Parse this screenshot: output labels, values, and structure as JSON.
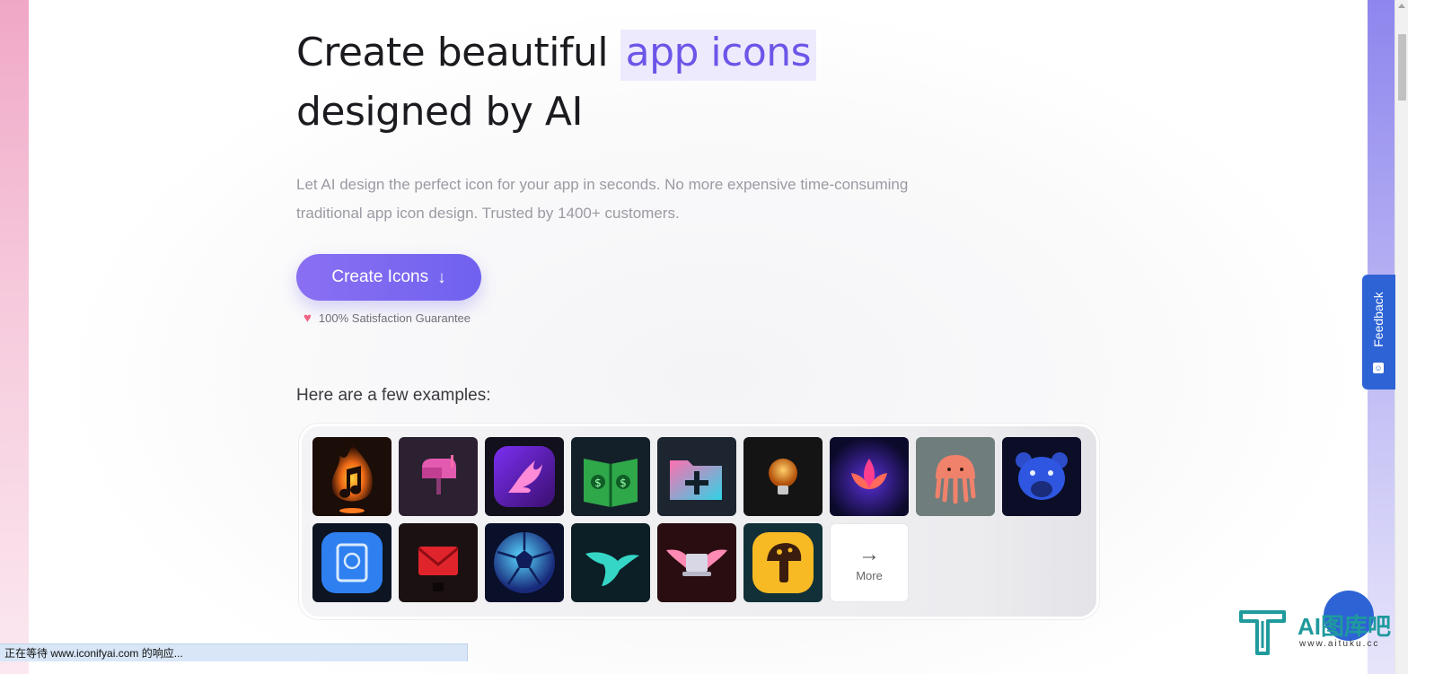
{
  "hero": {
    "headline_part1": "Create beautiful",
    "headline_highlight": "app icons",
    "headline_part2": "designed by AI",
    "subtitle": "Let AI design the perfect icon for your app in seconds. No more expensive time-consuming traditional app icon design. Trusted by 1400+ customers.",
    "cta_label": "Create Icons",
    "cta_icon": "arrow-down-icon",
    "guarantee_icon": "heart-icon",
    "guarantee_text": "100% Satisfaction Guarantee"
  },
  "examples": {
    "label": "Here are a few examples:",
    "icons": [
      "flaming-music-note-icon",
      "pink-mailbox-icon",
      "purple-phoenix-icon",
      "money-book-icon",
      "folder-plus-icon",
      "lightbulb-icon",
      "neon-lotus-icon",
      "jellyfish-icon",
      "blue-bear-icon",
      "blue-book-app-icon",
      "red-envelope-icon",
      "glowing-soccer-ball-icon",
      "teal-hummingbird-icon",
      "winged-laptop-icon",
      "mushroom-icon"
    ],
    "more_label": "More",
    "more_icon": "arrow-right-icon"
  },
  "feedback": {
    "label": "Feedback"
  },
  "status_bar": {
    "text": "正在等待 www.iconifyai.com 的响应..."
  },
  "watermark": {
    "title": "AI图库吧",
    "url": "www.aituku.cc"
  },
  "colors": {
    "accent": "#6b56e8",
    "highlight_bg": "#eeeafd",
    "cta_gradient_start": "#8a6ff2",
    "cta_gradient_end": "#6f62ef",
    "feedback_blue": "#2d63d5",
    "heart": "#f06383"
  }
}
